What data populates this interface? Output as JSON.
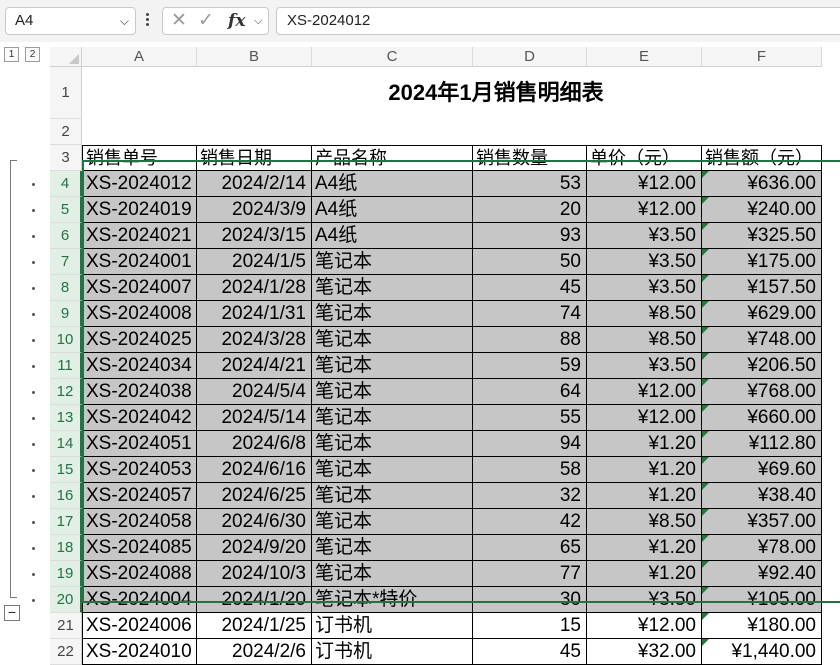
{
  "formula_bar": {
    "name_box": "A4",
    "chevron": "⌵",
    "formula": "XS-2024012",
    "cancel_icon": "✕",
    "confirm_icon": "✓",
    "fx_label": "fx",
    "fx_dropdown": "⌵"
  },
  "outline": {
    "level1": "1",
    "level2": "2",
    "collapse_symbol": "−"
  },
  "columns": [
    "A",
    "B",
    "C",
    "D",
    "E",
    "F"
  ],
  "row_numbers": [
    "1",
    "2",
    "3",
    "4",
    "5",
    "6",
    "7",
    "8",
    "9",
    "10",
    "11",
    "12",
    "13",
    "14",
    "15",
    "16",
    "17",
    "18",
    "19",
    "20",
    "21",
    "22"
  ],
  "sheet": {
    "title": "2024年1月销售明细表",
    "headers": [
      "销售单号",
      "销售日期",
      "产品名称",
      "销售数量",
      "单价（元）",
      "销售额（元）"
    ],
    "rows": [
      [
        "XS-2024012",
        "2024/2/14",
        "A4纸",
        "53",
        "¥12.00",
        "¥636.00"
      ],
      [
        "XS-2024019",
        "2024/3/9",
        "A4纸",
        "20",
        "¥12.00",
        "¥240.00"
      ],
      [
        "XS-2024021",
        "2024/3/15",
        "A4纸",
        "93",
        "¥3.50",
        "¥325.50"
      ],
      [
        "XS-2024001",
        "2024/1/5",
        "笔记本",
        "50",
        "¥3.50",
        "¥175.00"
      ],
      [
        "XS-2024007",
        "2024/1/28",
        "笔记本",
        "45",
        "¥3.50",
        "¥157.50"
      ],
      [
        "XS-2024008",
        "2024/1/31",
        "笔记本",
        "74",
        "¥8.50",
        "¥629.00"
      ],
      [
        "XS-2024025",
        "2024/3/28",
        "笔记本",
        "88",
        "¥8.50",
        "¥748.00"
      ],
      [
        "XS-2024034",
        "2024/4/21",
        "笔记本",
        "59",
        "¥3.50",
        "¥206.50"
      ],
      [
        "XS-2024038",
        "2024/5/4",
        "笔记本",
        "64",
        "¥12.00",
        "¥768.00"
      ],
      [
        "XS-2024042",
        "2024/5/14",
        "笔记本",
        "55",
        "¥12.00",
        "¥660.00"
      ],
      [
        "XS-2024051",
        "2024/6/8",
        "笔记本",
        "94",
        "¥1.20",
        "¥112.80"
      ],
      [
        "XS-2024053",
        "2024/6/16",
        "笔记本",
        "58",
        "¥1.20",
        "¥69.60"
      ],
      [
        "XS-2024057",
        "2024/6/25",
        "笔记本",
        "32",
        "¥1.20",
        "¥38.40"
      ],
      [
        "XS-2024058",
        "2024/6/30",
        "笔记本",
        "42",
        "¥8.50",
        "¥357.00"
      ],
      [
        "XS-2024085",
        "2024/9/20",
        "笔记本",
        "65",
        "¥1.20",
        "¥78.00"
      ],
      [
        "XS-2024088",
        "2024/10/3",
        "笔记本",
        "77",
        "¥1.20",
        "¥92.40"
      ],
      [
        "XS-2024004",
        "2024/1/20",
        "笔记本*特价",
        "30",
        "¥3.50",
        "¥105.00"
      ],
      [
        "XS-2024006",
        "2024/1/25",
        "订书机",
        "15",
        "¥12.00",
        "¥180.00"
      ],
      [
        "XS-2024010",
        "2024/2/6",
        "订书机",
        "45",
        "¥32.00",
        "¥1,440.00"
      ]
    ]
  },
  "colors": {
    "selection": "#217346",
    "shaded": "#c6c6c6",
    "error_flag": "#1f7a3c"
  }
}
